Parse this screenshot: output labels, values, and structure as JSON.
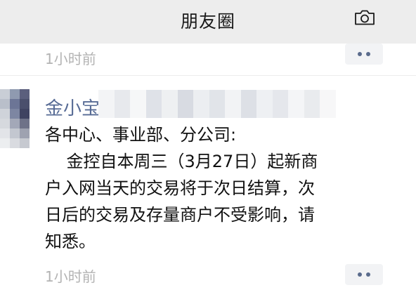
{
  "header": {
    "title": "朋友圈",
    "camera_icon": "camera-icon"
  },
  "previous_post": {
    "time": "1小时前"
  },
  "post": {
    "username": "金小宝",
    "lines": [
      "各中心、事业部、分公司:",
      "    金控自本周三（3月27日）起新商",
      "户入网当天的交易将于次日结算，次",
      "日后的交易及存量商户不受影响，请",
      "知悉。"
    ],
    "time": "1小时前"
  },
  "colors": {
    "header_bg": "#ededed",
    "username": "#576b95",
    "time": "#b3b3b3",
    "more_button_bg": "#f2f3f5",
    "more_dots": "#5a6b8c"
  }
}
